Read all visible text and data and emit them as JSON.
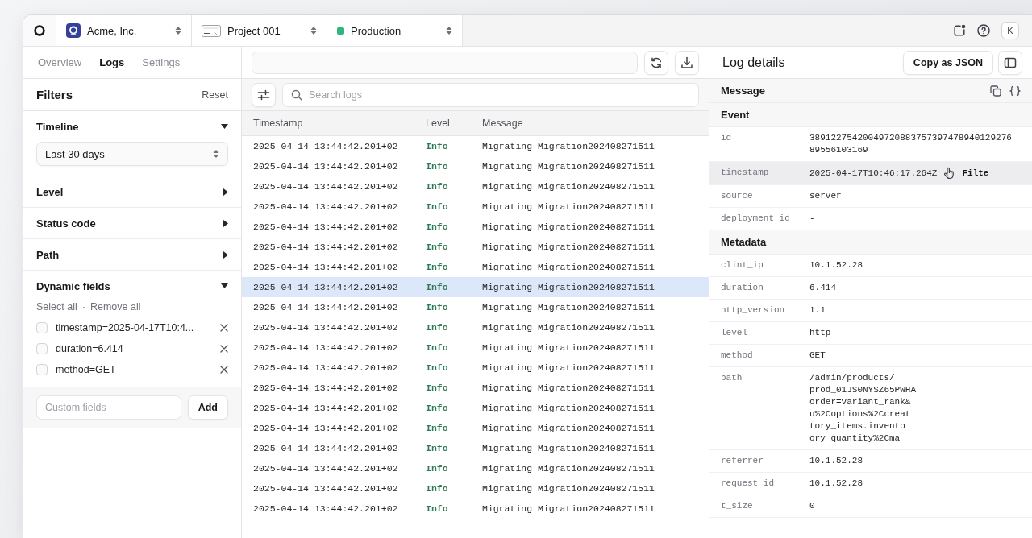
{
  "top_bar": {
    "selectors": [
      {
        "kind": "org",
        "label": "Acme, Inc."
      },
      {
        "kind": "project",
        "label": "Project 001"
      },
      {
        "kind": "environment",
        "label": "Production"
      }
    ],
    "avatar": "K"
  },
  "nav_tabs": [
    {
      "label": "Overview",
      "selected": false
    },
    {
      "label": "Logs",
      "selected": true
    },
    {
      "label": "Settings",
      "selected": false
    }
  ],
  "filters": {
    "title": "Filters",
    "reset": "Reset",
    "sections": [
      {
        "kind": "select",
        "title": "Timeline",
        "expanded": true,
        "value": "Last 30 days"
      },
      {
        "kind": "plain",
        "title": "Level",
        "expanded": false
      },
      {
        "kind": "plain",
        "title": "Status code",
        "expanded": false
      },
      {
        "kind": "plain",
        "title": "Path",
        "expanded": false
      },
      {
        "kind": "fields",
        "title": "Dynamic fields",
        "expanded": true,
        "select_all": "Select all",
        "separator": "·",
        "remove_all": "Remove all",
        "items": [
          {
            "label": "timestamp=2025-04-17T10:4...",
            "checked": false
          },
          {
            "label": "duration=6.414",
            "checked": false
          },
          {
            "label": "method=GET",
            "checked": false
          }
        ],
        "custom_field": {
          "placeholder": "Custom fields",
          "button": "Add"
        }
      }
    ]
  },
  "log_toolbar": {
    "search_placeholder": "Search logs"
  },
  "log_table": {
    "columns": [
      "Timestamp",
      "Level",
      "Message"
    ],
    "rows": [
      {
        "timestamp": "2025-04-14 13:44:42.201+02",
        "level": "Info",
        "message": "Migrating Migration202408271511",
        "selected": false
      },
      {
        "timestamp": "2025-04-14 13:44:42.201+02",
        "level": "Info",
        "message": "Migrating Migration202408271511",
        "selected": false
      },
      {
        "timestamp": "2025-04-14 13:44:42.201+02",
        "level": "Info",
        "message": "Migrating Migration202408271511",
        "selected": false
      },
      {
        "timestamp": "2025-04-14 13:44:42.201+02",
        "level": "Info",
        "message": "Migrating Migration202408271511",
        "selected": false
      },
      {
        "timestamp": "2025-04-14 13:44:42.201+02",
        "level": "Info",
        "message": "Migrating Migration202408271511",
        "selected": false
      },
      {
        "timestamp": "2025-04-14 13:44:42.201+02",
        "level": "Info",
        "message": "Migrating Migration202408271511",
        "selected": false
      },
      {
        "timestamp": "2025-04-14 13:44:42.201+02",
        "level": "Info",
        "message": "Migrating Migration202408271511",
        "selected": false
      },
      {
        "timestamp": "2025-04-14 13:44:42.201+02",
        "level": "Info",
        "message": "Migrating Migration202408271511",
        "selected": true
      },
      {
        "timestamp": "2025-04-14 13:44:42.201+02",
        "level": "Info",
        "message": "Migrating Migration202408271511",
        "selected": false
      },
      {
        "timestamp": "2025-04-14 13:44:42.201+02",
        "level": "Info",
        "message": "Migrating Migration202408271511",
        "selected": false
      },
      {
        "timestamp": "2025-04-14 13:44:42.201+02",
        "level": "Info",
        "message": "Migrating Migration202408271511",
        "selected": false
      },
      {
        "timestamp": "2025-04-14 13:44:42.201+02",
        "level": "Info",
        "message": "Migrating Migration202408271511",
        "selected": false
      },
      {
        "timestamp": "2025-04-14 13:44:42.201+02",
        "level": "Info",
        "message": "Migrating Migration202408271511",
        "selected": false
      },
      {
        "timestamp": "2025-04-14 13:44:42.201+02",
        "level": "Info",
        "message": "Migrating Migration202408271511",
        "selected": false
      },
      {
        "timestamp": "2025-04-14 13:44:42.201+02",
        "level": "Info",
        "message": "Migrating Migration202408271511",
        "selected": false
      },
      {
        "timestamp": "2025-04-14 13:44:42.201+02",
        "level": "Info",
        "message": "Migrating Migration202408271511",
        "selected": false
      },
      {
        "timestamp": "2025-04-14 13:44:42.201+02",
        "level": "Info",
        "message": "Migrating Migration202408271511",
        "selected": false
      },
      {
        "timestamp": "2025-04-14 13:44:42.201+02",
        "level": "Info",
        "message": "Migrating Migration202408271511",
        "selected": false
      },
      {
        "timestamp": "2025-04-14 13:44:42.201+02",
        "level": "Info",
        "message": "Migrating Migration202408271511",
        "selected": false
      }
    ]
  },
  "log_details": {
    "title": "Log details",
    "copy_button": "Copy as JSON",
    "message_title": "Message",
    "groups": [
      {
        "title": "Event",
        "fields": [
          {
            "key": "id",
            "lines": [
              "38912275420049720883757397478940129276",
              "89556103169"
            ],
            "hovered": false
          },
          {
            "key": "timestamp",
            "lines": [
              "2025-04-17T10:46:17.264Z"
            ],
            "hovered": true,
            "action": "Filte"
          },
          {
            "key": "source",
            "lines": [
              "server"
            ],
            "hovered": false
          },
          {
            "key": "deployment_id",
            "lines": [
              "-"
            ],
            "hovered": false
          }
        ]
      },
      {
        "title": "Metadata",
        "fields": [
          {
            "key": "clint_ip",
            "lines": [
              "10.1.52.28"
            ],
            "hovered": false
          },
          {
            "key": "duration",
            "lines": [
              "6.414"
            ],
            "hovered": false
          },
          {
            "key": "http_version",
            "lines": [
              "1.1"
            ],
            "hovered": false
          },
          {
            "key": "level",
            "lines": [
              "http"
            ],
            "hovered": false
          },
          {
            "key": "method",
            "lines": [
              "GET"
            ],
            "hovered": false
          },
          {
            "key": "path",
            "lines": [
              "/admin/products/",
              "prod_01JS0NYSZ65PWHA",
              "order=variant_rank&",
              "u%2Coptions%2Ccreat",
              "tory_items.invento",
              "ory_quantity%2Cma"
            ],
            "hovered": false
          },
          {
            "key": "referrer",
            "lines": [
              "10.1.52.28"
            ],
            "hovered": false
          },
          {
            "key": "request_id",
            "lines": [
              "10.1.52.28"
            ],
            "hovered": false
          },
          {
            "key": "t_size",
            "lines": [
              "0"
            ],
            "hovered": false
          }
        ]
      }
    ]
  }
}
